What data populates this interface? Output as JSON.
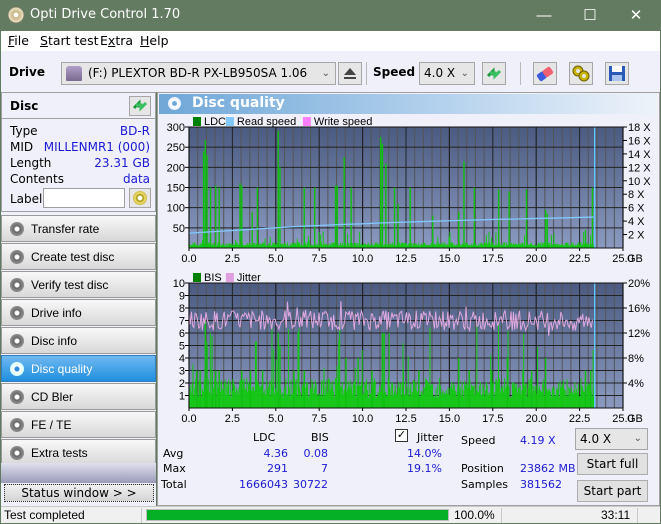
{
  "window": {
    "title": "Opti Drive Control 1.70",
    "minimize": "—",
    "maximize": "☐",
    "close": "✕"
  },
  "menu": [
    {
      "label": "File",
      "key": "F",
      "rest": "ile"
    },
    {
      "label": "Start test",
      "key": "S",
      "rest": "tart test"
    },
    {
      "label": "Extra",
      "key": "x",
      "pre": "E",
      "rest": "tra"
    },
    {
      "label": "Help",
      "key": "H",
      "rest": "elp"
    }
  ],
  "toolbar": {
    "drive_label": "Drive",
    "drive_value": "(F:)  PLEXTOR BD-R  PX-LB950SA 1.06",
    "speed_label": "Speed",
    "speed_value": "4.0 X",
    "icons": [
      "drive-icon",
      "eject-icon",
      "refresh-icon",
      "eraser-icon",
      "settings-icon",
      "save-icon"
    ]
  },
  "disc": {
    "header": "Disc",
    "fields": [
      {
        "label": "Type",
        "value": "BD-R"
      },
      {
        "label": "MID",
        "value": "MILLENMR1 (000)"
      },
      {
        "label": "Length",
        "value": "23.31 GB"
      },
      {
        "label": "Contents",
        "value": "data"
      }
    ],
    "label_field": "Label",
    "label_value": ""
  },
  "nav": [
    {
      "label": "Transfer rate",
      "active": false
    },
    {
      "label": "Create test disc",
      "active": false
    },
    {
      "label": "Verify test disc",
      "active": false
    },
    {
      "label": "Drive info",
      "active": false
    },
    {
      "label": "Disc info",
      "active": false
    },
    {
      "label": "Disc quality",
      "active": true
    },
    {
      "label": "CD Bler",
      "active": false
    },
    {
      "label": "FE / TE",
      "active": false
    },
    {
      "label": "Extra tests",
      "active": false
    }
  ],
  "status_window_btn": "Status window > >",
  "panel_title": "Disc quality",
  "chart_data": [
    {
      "type": "bar",
      "title": "LDC / Read speed",
      "legend": [
        {
          "name": "LDC",
          "color": "#008000"
        },
        {
          "name": "Read speed",
          "color": "#80c8ff"
        },
        {
          "name": "Write speed",
          "color": "#ff80ff"
        }
      ],
      "xlabel": "GB",
      "xlim": [
        0,
        25
      ],
      "xticks": [
        "0.0",
        "2.5",
        "5.0",
        "7.5",
        "10.0",
        "12.5",
        "15.0",
        "17.5",
        "20.0",
        "22.5",
        "25.0"
      ],
      "ylim": [
        0,
        300
      ],
      "yticks": [
        "50",
        "100",
        "150",
        "200",
        "250",
        "300"
      ],
      "y2lim": [
        0,
        18
      ],
      "y2ticks": [
        "2 X",
        "4 X",
        "6 X",
        "8 X",
        "10 X",
        "12 X",
        "14 X",
        "16 X",
        "18 X"
      ],
      "data_end_gb": 23.31,
      "ldc_baseline": 12,
      "ldc_spikes": [
        [
          0.8,
          240
        ],
        [
          0.9,
          268
        ],
        [
          1.0,
          230
        ],
        [
          1.2,
          150
        ],
        [
          1.5,
          155
        ],
        [
          1.7,
          150
        ],
        [
          2.9,
          160
        ],
        [
          3.0,
          155
        ],
        [
          3.6,
          90
        ],
        [
          3.9,
          150
        ],
        [
          5.1,
          291
        ],
        [
          5.2,
          200
        ],
        [
          6.6,
          150
        ],
        [
          7.2,
          150
        ],
        [
          8.4,
          155
        ],
        [
          8.5,
          155
        ],
        [
          8.9,
          225
        ],
        [
          9.3,
          150
        ],
        [
          11.0,
          275
        ],
        [
          11.1,
          258
        ],
        [
          11.3,
          210
        ],
        [
          11.8,
          150
        ],
        [
          12.0,
          110
        ],
        [
          12.7,
          150
        ],
        [
          14.0,
          80
        ],
        [
          15.5,
          90
        ],
        [
          15.8,
          215
        ],
        [
          16.4,
          150
        ],
        [
          17.8,
          145
        ],
        [
          18.4,
          140
        ],
        [
          19.4,
          145
        ],
        [
          20.5,
          95
        ],
        [
          20.6,
          85
        ],
        [
          22.8,
          45
        ],
        [
          23.2,
          150
        ]
      ],
      "read_speed": [
        [
          0,
          2.2
        ],
        [
          1.2,
          2.4
        ],
        [
          2.5,
          2.6
        ],
        [
          3.7,
          2.8
        ],
        [
          5.0,
          3.0
        ],
        [
          6.2,
          3.2
        ],
        [
          7.5,
          3.35
        ],
        [
          8.7,
          3.5
        ],
        [
          10.0,
          3.6
        ],
        [
          11.2,
          3.75
        ],
        [
          12.5,
          3.85
        ],
        [
          13.7,
          3.95
        ],
        [
          15.0,
          4.05
        ],
        [
          16.2,
          4.15
        ],
        [
          17.5,
          4.25
        ],
        [
          18.7,
          4.3
        ],
        [
          20.0,
          4.4
        ],
        [
          21.2,
          4.45
        ],
        [
          22.5,
          4.55
        ],
        [
          23.31,
          4.6
        ]
      ]
    },
    {
      "type": "bar",
      "title": "BIS / Jitter",
      "legend": [
        {
          "name": "BIS",
          "color": "#008000"
        },
        {
          "name": "Jitter",
          "color": "#e0a0e0"
        }
      ],
      "xlabel": "GB",
      "xlim": [
        0,
        25
      ],
      "xticks": [
        "0.0",
        "2.5",
        "5.0",
        "7.5",
        "10.0",
        "12.5",
        "15.0",
        "17.5",
        "20.0",
        "22.5",
        "25.0"
      ],
      "ylim": [
        0,
        10
      ],
      "yticks": [
        "1",
        "2",
        "3",
        "4",
        "5",
        "6",
        "7",
        "8",
        "9",
        "10"
      ],
      "y2lim": [
        0,
        20
      ],
      "y2ticks": [
        "4%",
        "8%",
        "12%",
        "16%",
        "20%"
      ],
      "data_end_gb": 23.31,
      "bis_baseline": 2,
      "bis_spikes": [
        [
          0.4,
          3
        ],
        [
          0.6,
          3
        ],
        [
          0.9,
          7
        ],
        [
          1.0,
          5
        ],
        [
          1.3,
          3
        ],
        [
          1.5,
          3
        ],
        [
          1.7,
          3
        ],
        [
          3.0,
          3
        ],
        [
          3.5,
          3
        ],
        [
          4.2,
          3
        ],
        [
          5.1,
          6
        ],
        [
          5.2,
          5
        ],
        [
          6.0,
          3
        ],
        [
          6.6,
          3
        ],
        [
          8.6,
          3
        ],
        [
          9.0,
          4
        ],
        [
          9.7,
          4
        ],
        [
          10.5,
          3
        ],
        [
          11.1,
          6
        ],
        [
          11.2,
          6
        ],
        [
          12.3,
          3
        ],
        [
          13.2,
          3
        ],
        [
          15.5,
          4
        ],
        [
          16.1,
          3
        ],
        [
          17.4,
          3
        ],
        [
          18.3,
          4
        ],
        [
          19.2,
          3
        ],
        [
          19.7,
          3
        ],
        [
          20.5,
          4
        ],
        [
          22.8,
          3
        ],
        [
          23.1,
          3
        ]
      ],
      "jitter_avg_pct": 14.0,
      "jitter_max_pct": 19.1
    }
  ],
  "stats": {
    "col_ldc": "LDC",
    "col_bis": "BIS",
    "jitter_label": "Jitter",
    "jitter_checked": true,
    "rows": [
      {
        "label": "Avg",
        "ldc": "4.36",
        "bis": "0.08",
        "jitter": "14.0%"
      },
      {
        "label": "Max",
        "ldc": "291",
        "bis": "7",
        "jitter": "19.1%"
      },
      {
        "label": "Total",
        "ldc": "1666043",
        "bis": "30722",
        "jitter": ""
      }
    ],
    "speed_label": "Speed",
    "speed_value": "4.19 X",
    "position_label": "Position",
    "position_value": "23862 MB",
    "samples_label": "Samples",
    "samples_value": "381562",
    "speed_select": "4.0 X",
    "start_full": "Start full",
    "start_part": "Start part"
  },
  "statusbar": {
    "text": "Test completed",
    "progress_pct": 100,
    "progress_text": "100.0%",
    "time": "33:11"
  }
}
